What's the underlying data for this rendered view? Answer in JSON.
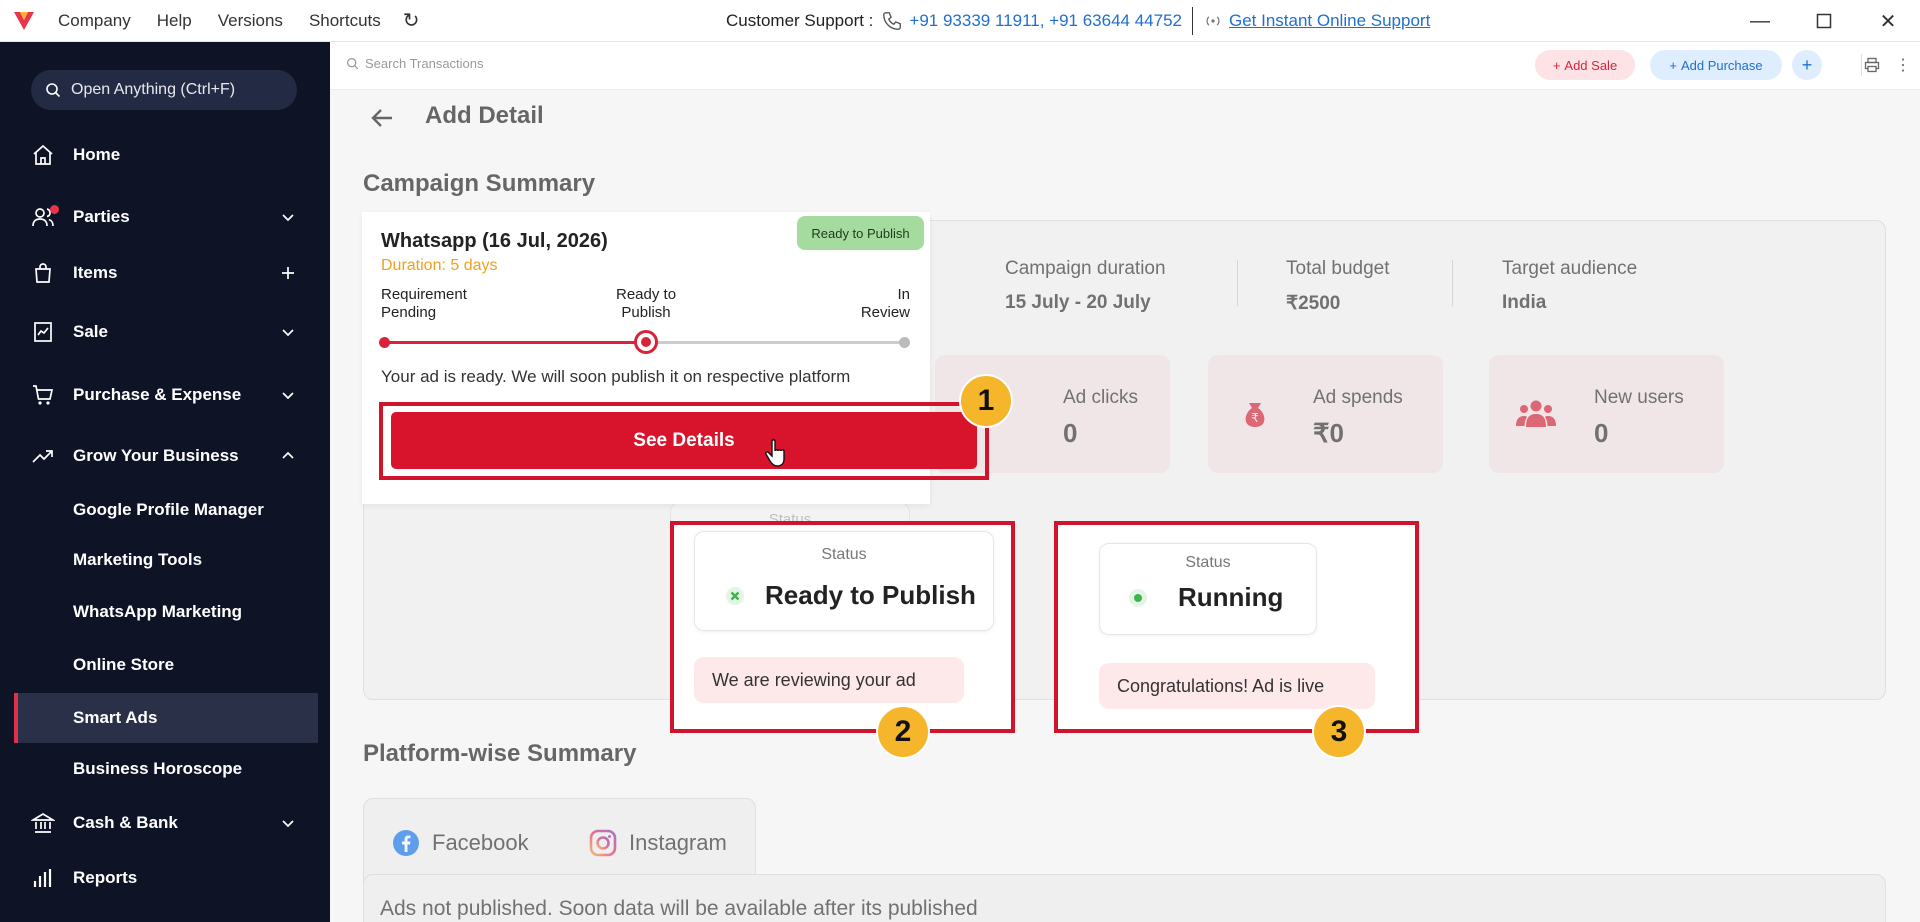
{
  "topbar": {
    "menu": [
      "Company",
      "Help",
      "Versions",
      "Shortcuts"
    ],
    "support_label": "Customer Support :",
    "support_phones": "+91 93339 11911, +91 63644 44752",
    "online_support": "Get Instant Online Support"
  },
  "sidebar": {
    "search_placeholder": "Open Anything (Ctrl+F)",
    "items": [
      {
        "label": "Home",
        "icon": "home-icon"
      },
      {
        "label": "Parties",
        "icon": "users-icon"
      },
      {
        "label": "Items",
        "icon": "bag-icon"
      },
      {
        "label": "Sale",
        "icon": "receipt-icon"
      },
      {
        "label": "Purchase & Expense",
        "icon": "cart-icon"
      },
      {
        "label": "Grow Your Business",
        "icon": "trend-icon"
      },
      {
        "label": "Cash & Bank",
        "icon": "bank-icon"
      },
      {
        "label": "Reports",
        "icon": "bar-chart-icon"
      }
    ],
    "sub_items": [
      "Google Profile Manager",
      "Marketing Tools",
      "WhatsApp Marketing",
      "Online Store",
      "Smart Ads",
      "Business Horoscope"
    ],
    "active_sub_item": "Smart Ads"
  },
  "content_top": {
    "search_placeholder": "Search Transactions",
    "add_sale": "Add Sale",
    "add_purchase": "Add Purchase"
  },
  "page": {
    "title": "Add Detail",
    "campaign_summary_title": "Campaign Summary",
    "platform_summary_title": "Platform-wise Summary"
  },
  "summary": {
    "duration_label": "Campaign duration",
    "duration_value": "15 July - 20 July",
    "budget_label": "Total budget",
    "budget_value": "₹2500",
    "audience_label": "Target audience",
    "audience_value": "India"
  },
  "metrics": [
    {
      "label": "Ad clicks",
      "value": "0",
      "icon": "cursor-icon"
    },
    {
      "label": "Ad spends",
      "value": "₹0",
      "icon": "money-bag-icon"
    },
    {
      "label": "New users",
      "value": "0",
      "icon": "group-icon"
    }
  ],
  "campaign_card": {
    "title": "Whatsapp (16 Jul, 2026)",
    "duration": "Duration: 5 days",
    "badge": "Ready to Publish",
    "steps": [
      {
        "line1": "Requirement",
        "line2": "Pending"
      },
      {
        "line1": "Ready to",
        "line2": "Publish"
      },
      {
        "line1": "In",
        "line2": "Review"
      }
    ],
    "current_step": 2,
    "message": "Your ad is ready. We will soon publish it on respective platform",
    "button": "See Details"
  },
  "status_panels": [
    {
      "number": "2",
      "label": "Status",
      "value": "Ready to Publish",
      "message": "We are reviewing your ad"
    },
    {
      "number": "3",
      "label": "Status",
      "value": "Running",
      "message": "Congratulations! Ad is live"
    }
  ],
  "callout_1": "1",
  "faded_status_label": "Status",
  "platforms": {
    "tabs": [
      "Facebook",
      "Instagram"
    ],
    "notice": "Ads not published. Soon data will be available after its published"
  },
  "colors": {
    "sidebar_bg": "#0e1326",
    "accent_red": "#d8142c",
    "callout_yellow": "#f6b62b",
    "link_blue": "#1f6fd1"
  }
}
